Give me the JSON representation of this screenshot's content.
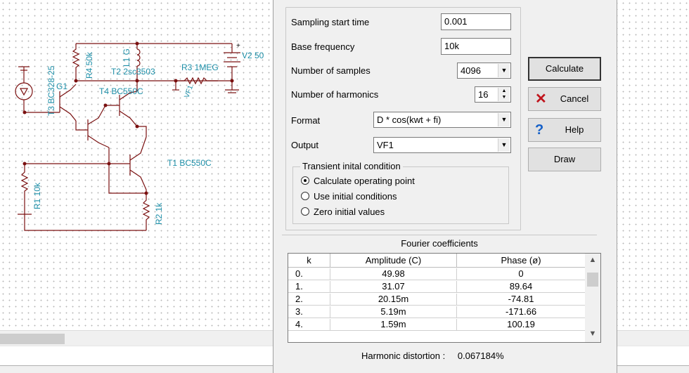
{
  "circuit": {
    "labels": {
      "v2": "V2 50",
      "r4": "R4 50k",
      "l1": "L1 G",
      "t2": "T2 2sc3503",
      "r3": "R3 1MEG",
      "vf1": "VF1",
      "t3": "T3 BC328-25",
      "g1": "G1",
      "t4": "T4 BC550C",
      "t1": "T1 BC550C",
      "r1": "R1 10k",
      "r2": "R2 1k",
      "plus": "+"
    },
    "colors": {
      "wire": "#7a1010",
      "label": "#1e8fa8"
    }
  },
  "dialog": {
    "fields": {
      "start_time_label": "Sampling start time",
      "start_time_value": "0.001",
      "base_freq_label": "Base frequency",
      "base_freq_value": "10k",
      "samples_label": "Number of samples",
      "samples_value": "4096",
      "harmonics_label": "Number of harmonics",
      "harmonics_value": "16",
      "format_label": "Format",
      "format_value": "D * cos(kwt + fi)",
      "output_label": "Output",
      "output_value": "VF1"
    },
    "transient": {
      "title": "Transient inital condition",
      "options": [
        "Calculate operating point",
        "Use initial conditions",
        "Zero initial values"
      ],
      "selected": 0
    },
    "buttons": {
      "calculate": "Calculate",
      "cancel": "Cancel",
      "help": "Help",
      "draw": "Draw"
    },
    "fourier": {
      "title": "Fourier coefficients",
      "columns": [
        "k",
        "Amplitude (C)",
        "Phase (ø)"
      ],
      "rows": [
        [
          "0.",
          "49.98",
          "0"
        ],
        [
          "1.",
          "31.07",
          "89.64"
        ],
        [
          "2.",
          "20.15m",
          "-74.81"
        ],
        [
          "3.",
          "5.19m",
          "-171.66"
        ],
        [
          "4.",
          "1.59m",
          "100.19"
        ]
      ],
      "distortion_label": "Harmonic distortion :",
      "distortion_value": "0.067184%"
    }
  }
}
